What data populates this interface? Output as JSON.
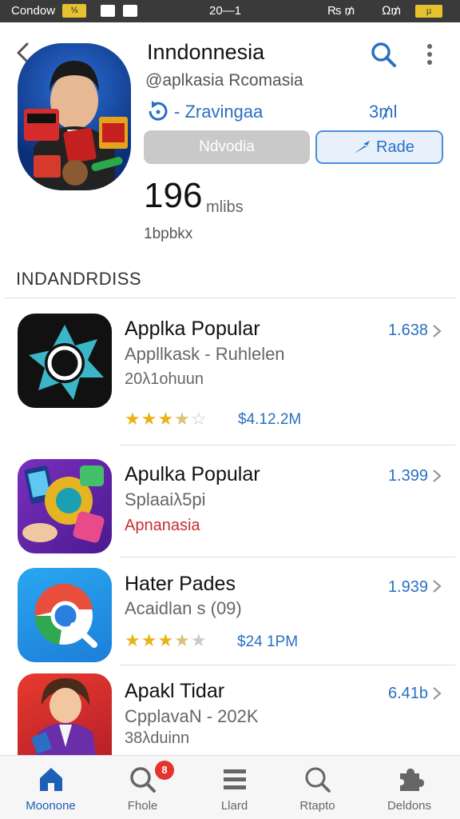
{
  "status_bar": {
    "carrier": "Condow",
    "sim": "⅓",
    "time": "20—1",
    "signal": "₨ ₥",
    "network": "Ω₥",
    "battery": "µ"
  },
  "app": {
    "title": "Inndonnesia",
    "developer": "@aplkasia Rcomasia",
    "dev_label": "- Zravingaa",
    "dev_count": "3₥l",
    "download_label": "Ndvodia",
    "rate_label": "Rade",
    "stat_number": "196",
    "stat_unit": "mlibs",
    "stat_sub": "1bpbkx"
  },
  "section": {
    "title": "INDANDRDISS"
  },
  "list": [
    {
      "title": "Applka Popular",
      "subtitle": "Appllkask - Ruhlelen",
      "extra": "20λ1ohuun",
      "rating": "1.638",
      "stars": "3.5",
      "price": "$4.12.2M"
    },
    {
      "title": "Apulka Popular",
      "subtitle": "Splaaiλ5pi",
      "extra": "Apnanasia",
      "rating": "1.399"
    },
    {
      "title": "Hater Pades",
      "subtitle": "Acaidlan s (09)",
      "rating": "1.939",
      "stars": "3.5",
      "price": "$24 1PM"
    },
    {
      "title": "Apakl Tidar",
      "subtitle": "CpplavaN - 202K",
      "extra": "38λduinn",
      "rating": "6.41b"
    }
  ],
  "nav": [
    {
      "label": "Moonone",
      "icon": "home-icon",
      "active": true
    },
    {
      "label": "Fhole",
      "icon": "search-icon",
      "badge": "8"
    },
    {
      "label": "Llard",
      "icon": "list-icon"
    },
    {
      "label": "Rtapto",
      "icon": "search-icon"
    },
    {
      "label": "Deldons",
      "icon": "puzzle-icon"
    }
  ],
  "colors": {
    "accent": "#2a6fc2",
    "star": "#e9b215",
    "badge": "#e3342f",
    "status_bar": "#3a3a3a"
  }
}
